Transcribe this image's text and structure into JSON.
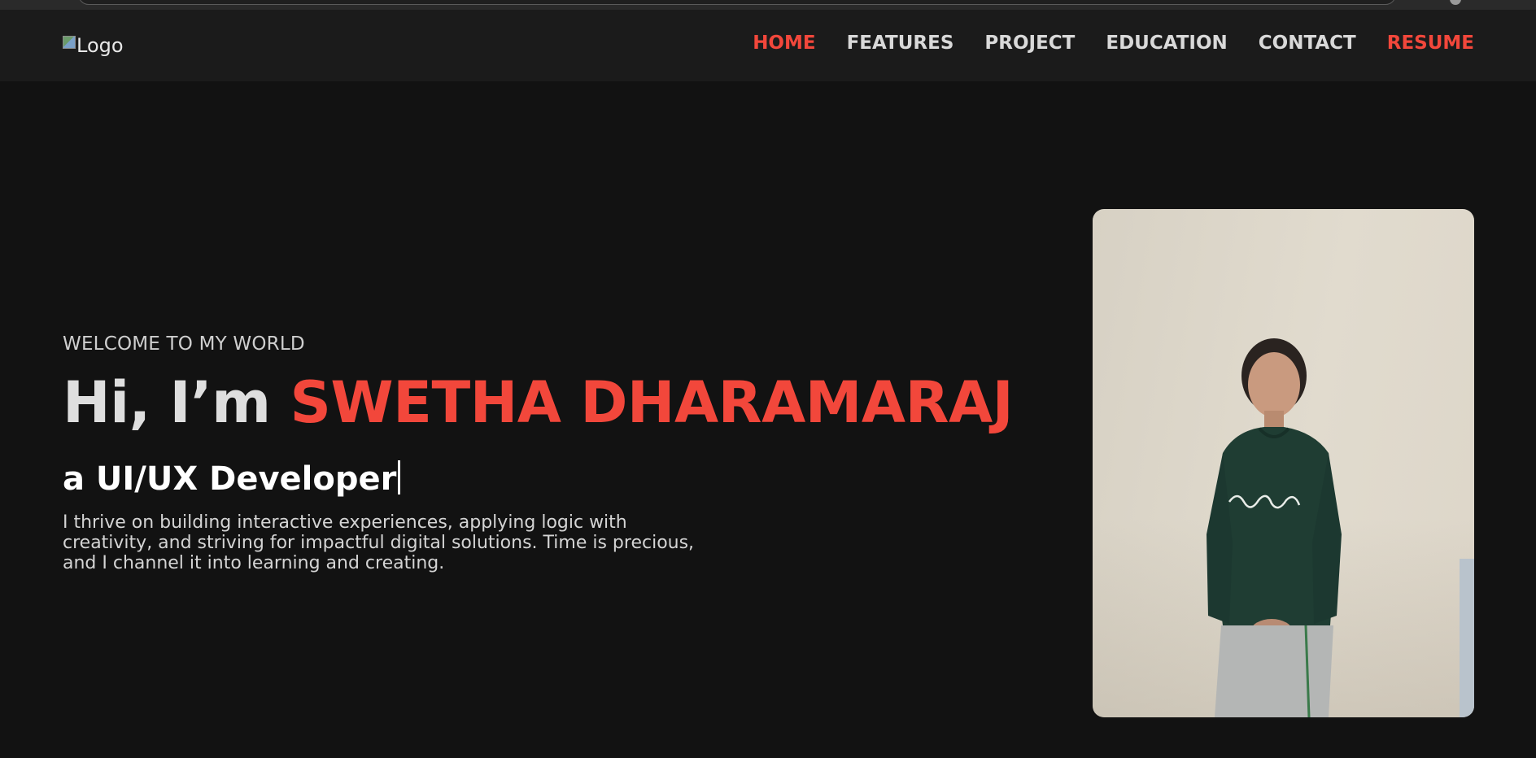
{
  "nav": {
    "logo_alt": "Logo",
    "items": [
      {
        "label": "HOME",
        "state": "active"
      },
      {
        "label": "FEATURES"
      },
      {
        "label": "PROJECT"
      },
      {
        "label": "EDUCATION"
      },
      {
        "label": "CONTACT"
      },
      {
        "label": "RESUME",
        "state": "highlight"
      }
    ]
  },
  "hero": {
    "eyebrow": "WELCOME TO MY WORLD",
    "greeting": "Hi, I’m ",
    "name": "SWETHA DHARAMARAJ",
    "role": "a UI/UX Developer",
    "bio": "I thrive on building interactive experiences, applying logic with creativity, and striving for impactful digital solutions. Time is precious, and I channel it into learning and creating."
  },
  "colors": {
    "accent": "#f2473b",
    "background": "#121212",
    "navbar": "#1b1b1b",
    "text": "#d9d9d9"
  },
  "icons": {
    "logo": "broken-image-icon",
    "photo": "profile-photo"
  }
}
